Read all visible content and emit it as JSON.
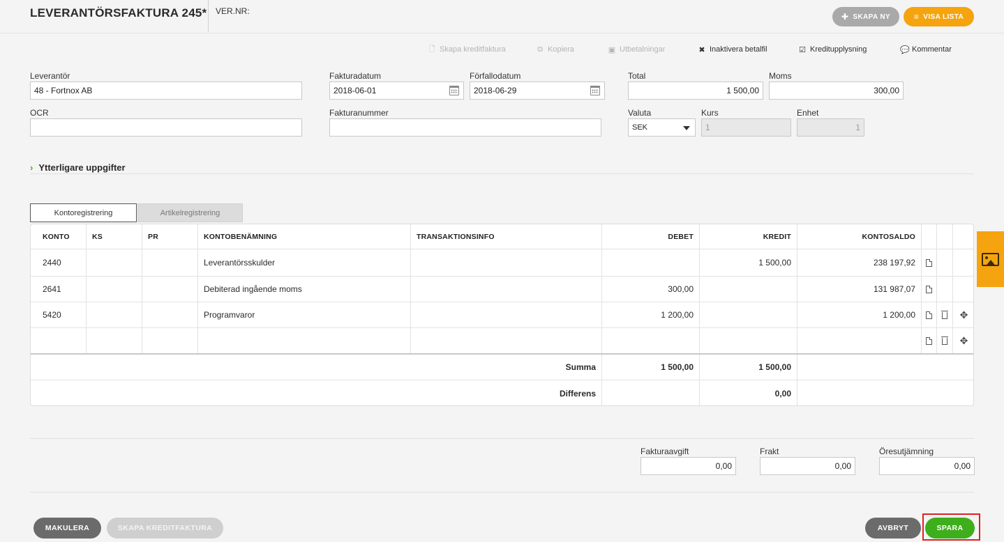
{
  "header": {
    "title": "LEVERANTÖRSFAKTURA 245*",
    "vernr": "VER.NR:",
    "create_new": "SKAPA NY",
    "show_list": "VISA LISTA"
  },
  "actions": {
    "create_credit": "Skapa kreditfaktura",
    "copy": "Kopiera",
    "payments": "Utbetalningar",
    "deactivate_payfile": "Inaktivera betalfil",
    "credit_info": "Kreditupplysning",
    "comment": "Kommentar"
  },
  "form": {
    "supplier_label": "Leverantör",
    "supplier_value": "48 - Fortnox AB",
    "invoice_date_label": "Fakturadatum",
    "invoice_date_value": "2018-06-01",
    "due_date_label": "Förfallodatum",
    "due_date_value": "2018-06-29",
    "total_label": "Total",
    "total_value": "1 500,00",
    "vat_label": "Moms",
    "vat_value": "300,00",
    "ocr_label": "OCR",
    "ocr_value": "",
    "invoice_number_label": "Fakturanummer",
    "invoice_number_value": "",
    "currency_label": "Valuta",
    "currency_value": "SEK",
    "rate_label": "Kurs",
    "rate_value": "1",
    "unit_label": "Enhet",
    "unit_value": "1"
  },
  "more_details": "Ytterligare uppgifter",
  "tabs": {
    "account": "Kontoregistrering",
    "article": "Artikelregistrering"
  },
  "table": {
    "headers": {
      "konto": "KONTO",
      "ks": "KS",
      "pr": "PR",
      "name": "KONTOBENÄMNING",
      "trans": "TRANSAKTIONSINFO",
      "debet": "DEBET",
      "kredit": "KREDIT",
      "saldo": "KONTOSALDO"
    },
    "rows": [
      {
        "konto": "2440",
        "ks": "",
        "pr": "",
        "name": "Leverantörsskulder",
        "trans": "",
        "debet": "",
        "kredit": "1 500,00",
        "saldo": "238 197,92"
      },
      {
        "konto": "2641",
        "ks": "",
        "pr": "",
        "name": "Debiterad ingående moms",
        "trans": "",
        "debet": "300,00",
        "kredit": "",
        "saldo": "131 987,07"
      },
      {
        "konto": "5420",
        "ks": "",
        "pr": "",
        "name": "Programvaror",
        "trans": "",
        "debet": "1 200,00",
        "kredit": "",
        "saldo": "1 200,00"
      },
      {
        "konto": "",
        "ks": "",
        "pr": "",
        "name": "",
        "trans": "",
        "debet": "",
        "kredit": "",
        "saldo": ""
      }
    ],
    "sum_label": "Summa",
    "sum_debet": "1 500,00",
    "sum_kredit": "1 500,00",
    "diff_label": "Differens",
    "diff_kredit": "0,00"
  },
  "fees": {
    "invoice_fee_label": "Fakturaavgift",
    "invoice_fee_value": "0,00",
    "freight_label": "Frakt",
    "freight_value": "0,00",
    "rounding_label": "Öresutjämning",
    "rounding_value": "0,00"
  },
  "footer": {
    "void": "MAKULERA",
    "create_credit": "SKAPA KREDITFAKTURA",
    "cancel": "AVBRYT",
    "save": "SPARA"
  },
  "colors": {
    "accent_orange": "#f5a40f",
    "save_green": "#3fae1c",
    "highlight_red": "#e02020"
  },
  "icons": {
    "create_new": "plus-icon",
    "show_list": "list-icon",
    "side_tab": "image-icon"
  }
}
